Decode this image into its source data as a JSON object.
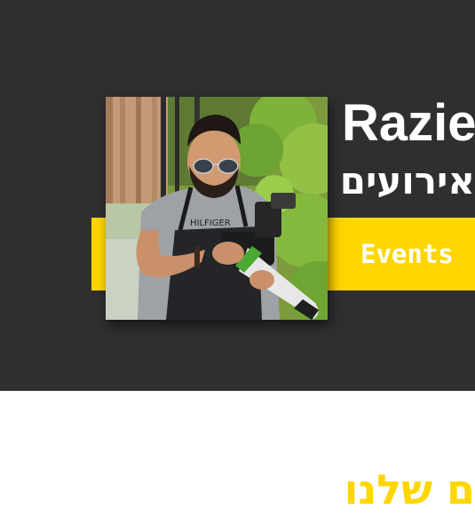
{
  "hero": {
    "name_title": "Razie",
    "subtitle_he": "אירועים",
    "events_label": "Events",
    "shirt_text": "HILFIGER"
  },
  "section": {
    "heading_he": "ם שלנו"
  },
  "colors": {
    "hero_background": "#302f30",
    "accent_yellow": "#ffd600",
    "text_white": "#ffffff"
  }
}
